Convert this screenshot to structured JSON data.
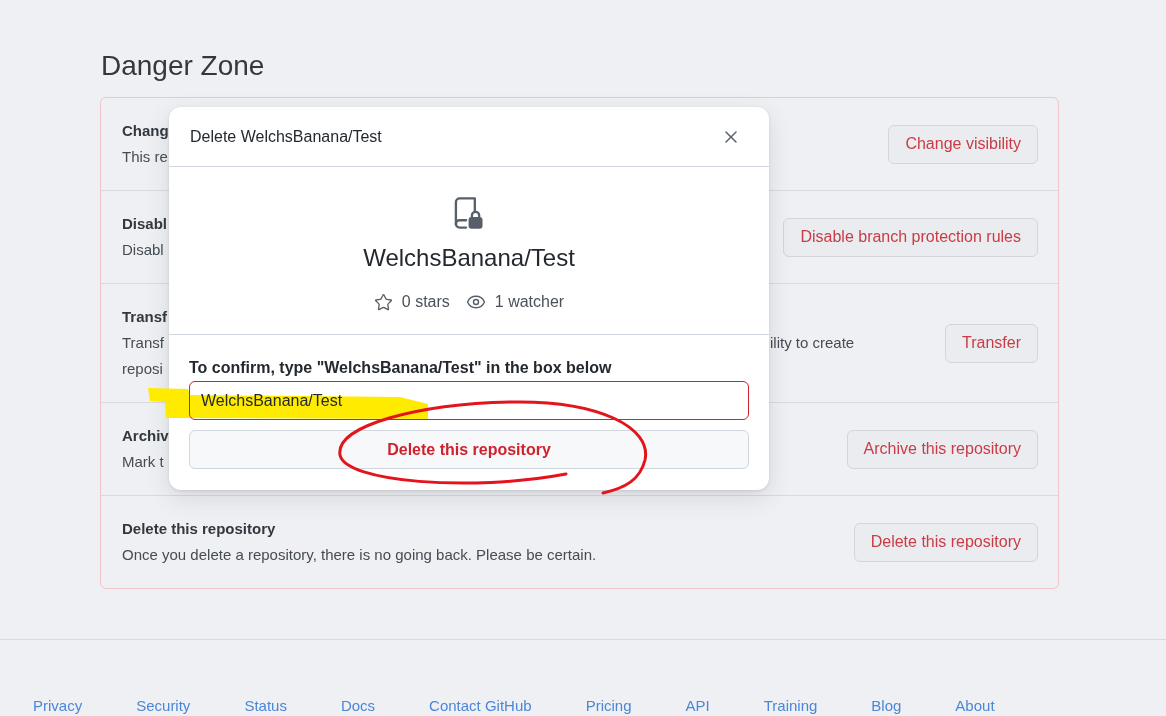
{
  "section": {
    "title": "Danger Zone"
  },
  "settings": [
    {
      "title": "Chang",
      "description": [
        "This re"
      ],
      "button": "Change visibility"
    },
    {
      "title": "Disabl",
      "description": [
        "Disabl"
      ],
      "button": "Disable branch protection rules"
    },
    {
      "title": "Transf",
      "description": [
        "Transf",
        "reposi"
      ],
      "description_tail": "ility to create",
      "button": "Transfer"
    },
    {
      "title": "Archiv",
      "description": [
        "Mark t"
      ],
      "button": "Archive this repository"
    },
    {
      "title": "Delete this repository",
      "description": [
        "Once you delete a repository, there is no going back. Please be certain."
      ],
      "button": "Delete this repository"
    }
  ],
  "dialog": {
    "title": "Delete WelchsBanana/Test",
    "repository": "WelchsBanana/Test",
    "stats": [
      {
        "kind": "stars",
        "label": "0 stars"
      },
      {
        "kind": "watchers",
        "label": "1 watcher"
      }
    ],
    "confirm_label": "To confirm, type \"WelchsBanana/Test\" in the box below",
    "confirm_input": {
      "value": "WelchsBanana/Test"
    },
    "confirm_button": "Delete this repository"
  },
  "footer": {
    "links": [
      "Privacy",
      "Security",
      "Status",
      "Docs",
      "Contact GitHub",
      "Pricing",
      "API",
      "Training",
      "Blog",
      "About"
    ]
  }
}
